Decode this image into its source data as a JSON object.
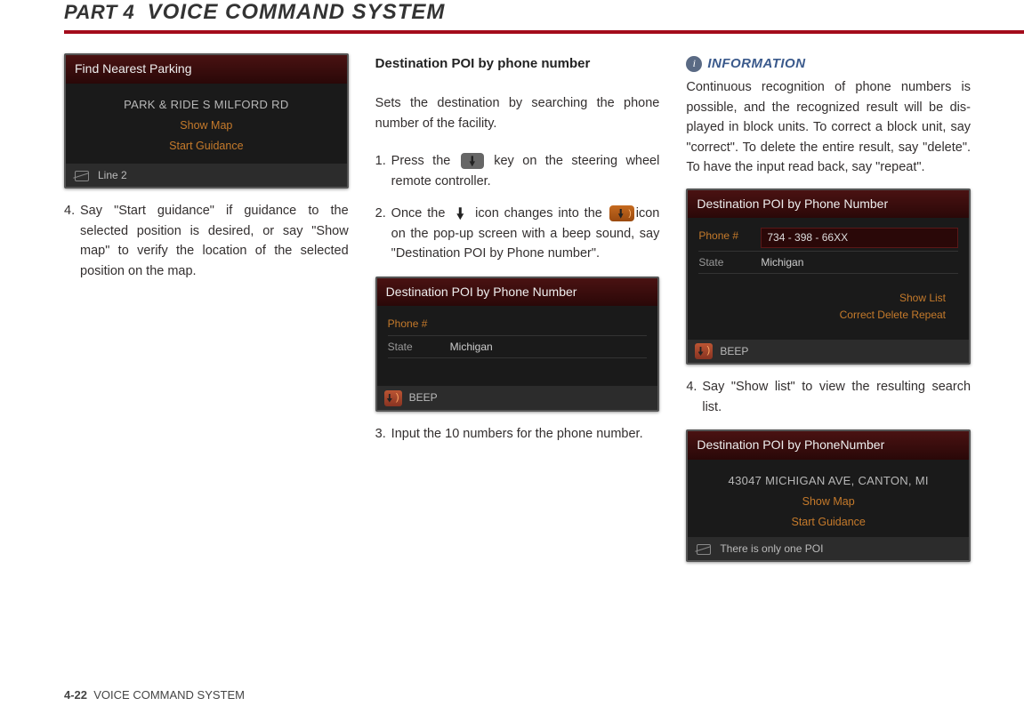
{
  "header": {
    "part": "PART 4",
    "title": "VOICE COMMAND SYSTEM"
  },
  "col1": {
    "screenshot1": {
      "title": "Find Nearest Parking",
      "poi": "PARK & RIDE S MILFORD RD",
      "action1": "Show Map",
      "action2": "Start Guidance",
      "footer": "Line 2"
    },
    "step4_num": "4.",
    "step4": "Say \"Start guidance\" if guidance to the selected position is desired, or say \"Show map\" to verify the location of the selected position on the map."
  },
  "col2": {
    "heading": "Destination POI by phone number",
    "intro": "Sets the destination by searching the phone number of the facility.",
    "step1_num": "1.",
    "step1a": "Press the ",
    "step1b": " key on the steering wheel remote controller.",
    "step2_num": "2.",
    "step2a": "Once the ",
    "step2b": " icon changes into the ",
    "step2c": "icon on the pop-up screen with a beep sound, say \"Destination POI by Phone number\".",
    "screenshot2": {
      "title": "Destination POI by Phone Number",
      "phone_label": "Phone #",
      "state_label": "State",
      "state_value": "Michigan",
      "footer": "BEEP"
    },
    "step3_num": "3.",
    "step3": "Input the 10 numbers for the phone num­ber."
  },
  "col3": {
    "info_label": "INFORMATION",
    "info_text": "Continuous recognition of phone numbers is possible, and the recognized result will be dis­played in block units. To correct a block unit, say \"correct\". To delete the entire result, say \"delete\". To have the input read back, say \"repeat\".",
    "screenshot3": {
      "title": "Destination POI by Phone Number",
      "phone_label": "Phone #",
      "phone_value": "734 - 398 - 66XX",
      "state_label": "State",
      "state_value": "Michigan",
      "action_line1": "Show List",
      "action_line2": "Correct   Delete   Repeat",
      "footer": "BEEP"
    },
    "step4_num": "4.",
    "step4": "Say \"Show list\" to view the resulting search list.",
    "screenshot4": {
      "title": "Destination POI by PhoneNumber",
      "address": "43047 MICHIGAN AVE, CANTON, MI",
      "action1": "Show Map",
      "action2": "Start Guidance",
      "footer": "There is only one POI"
    }
  },
  "footer": {
    "page": "4-22",
    "section": "VOICE COMMAND SYSTEM"
  }
}
